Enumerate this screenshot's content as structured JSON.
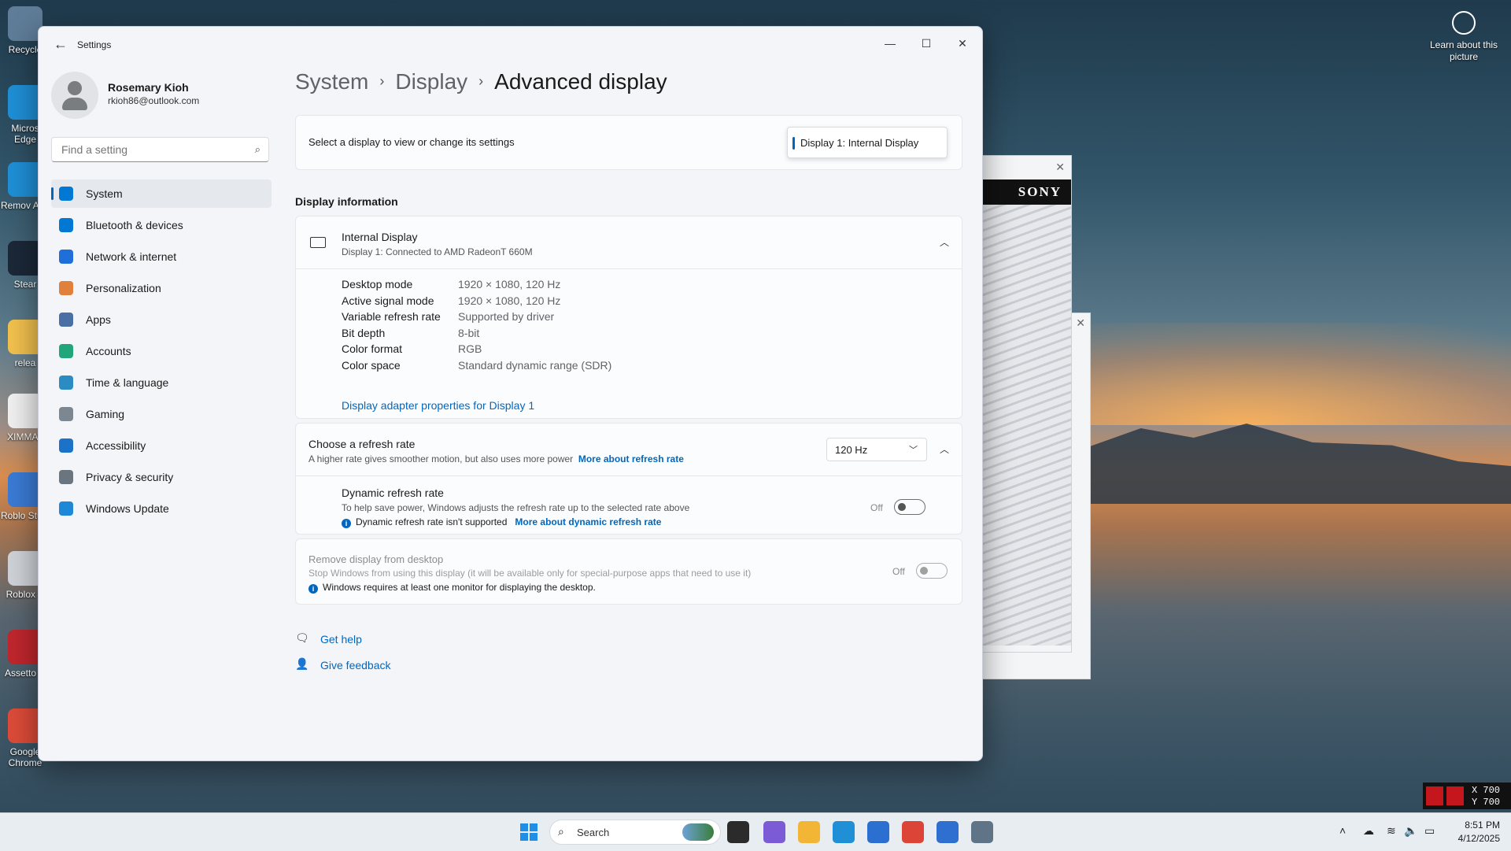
{
  "desktop": {
    "icons": [
      {
        "label": "Recycle",
        "color": "#5f7d98"
      },
      {
        "label": "Micros Edge",
        "color": "#1f8fd6"
      },
      {
        "label": "Remov App",
        "color": "#1f8fd6"
      },
      {
        "label": "Stear",
        "color": "#1b2838"
      },
      {
        "label": "relea",
        "color": "#f2c14e"
      },
      {
        "label": "XIMMAT",
        "color": "#f0f0f0"
      },
      {
        "label": "Roblo Studi",
        "color": "#3a7bd5"
      },
      {
        "label": "Roblox P",
        "color": "#cfd3d8"
      },
      {
        "label": "Assetto C",
        "color": "#c0262d"
      },
      {
        "label": "Google Chrome",
        "color": "#dd4b39"
      }
    ],
    "learn_about": "Learn about this picture",
    "coords": {
      "x": "X 700",
      "y": "Y 700"
    }
  },
  "window": {
    "app_title": "Settings",
    "controls": {
      "minimize": "—",
      "maximize": "☐",
      "close": "✕"
    },
    "back_icon": "←"
  },
  "profile": {
    "name": "Rosemary Kioh",
    "email": "rkioh86@outlook.com"
  },
  "search": {
    "placeholder": "Find a setting"
  },
  "nav": [
    {
      "label": "System",
      "icon": "system-icon",
      "color": "#0078d4",
      "selected": true
    },
    {
      "label": "Bluetooth & devices",
      "icon": "bluetooth-icon",
      "color": "#0078d4"
    },
    {
      "label": "Network & internet",
      "icon": "wifi-icon",
      "color": "#1e6fd9"
    },
    {
      "label": "Personalization",
      "icon": "brush-icon",
      "color": "#e0803a"
    },
    {
      "label": "Apps",
      "icon": "apps-icon",
      "color": "#4a6fa5"
    },
    {
      "label": "Accounts",
      "icon": "accounts-icon",
      "color": "#21a67a"
    },
    {
      "label": "Time & language",
      "icon": "clock-icon",
      "color": "#2b8cc4"
    },
    {
      "label": "Gaming",
      "icon": "gamepad-icon",
      "color": "#7d8791"
    },
    {
      "label": "Accessibility",
      "icon": "accessibility-icon",
      "color": "#1a73c9"
    },
    {
      "label": "Privacy & security",
      "icon": "shield-icon",
      "color": "#6b7580"
    },
    {
      "label": "Windows Update",
      "icon": "update-icon",
      "color": "#1e88d8"
    }
  ],
  "breadcrumb": {
    "level1": "System",
    "level2": "Display",
    "current": "Advanced display",
    "separator": "›"
  },
  "select_display": {
    "label": "Select a display to view or change its settings",
    "value": "Display 1: Internal Display"
  },
  "display_info": {
    "section_title": "Display information",
    "name": "Internal Display",
    "subtitle": "Display 1: Connected to AMD RadeonT 660M",
    "rows": [
      {
        "key": "Desktop mode",
        "value": "1920 × 1080, 120 Hz"
      },
      {
        "key": "Active signal mode",
        "value": "1920 × 1080, 120 Hz"
      },
      {
        "key": "Variable refresh rate",
        "value": "Supported by driver"
      },
      {
        "key": "Bit depth",
        "value": "8-bit"
      },
      {
        "key": "Color format",
        "value": "RGB"
      },
      {
        "key": "Color space",
        "value": "Standard dynamic range (SDR)"
      }
    ],
    "adapter_link": "Display adapter properties for Display 1"
  },
  "refresh": {
    "title": "Choose a refresh rate",
    "desc": "A higher rate gives smoother motion, but also uses more power",
    "link": "More about refresh rate",
    "value": "120 Hz"
  },
  "dynamic": {
    "title": "Dynamic refresh rate",
    "desc": "To help save power, Windows adjusts the refresh rate up to the selected rate above",
    "warning": "Dynamic refresh rate isn't supported",
    "link": "More about dynamic refresh rate",
    "state": "Off"
  },
  "remove_display": {
    "title": "Remove display from desktop",
    "desc": "Stop Windows from using this display (it will be available only for special-purpose apps that need to use it)",
    "note": "Windows requires at least one monitor for displaying the desktop.",
    "state": "Off"
  },
  "help": {
    "get_help": "Get help",
    "give_feedback": "Give feedback"
  },
  "sony": {
    "brand": "SONY",
    "close": "✕"
  },
  "taskbar": {
    "search_label": "Search",
    "time": "8:51 PM",
    "date": "4/12/2025",
    "apps": [
      {
        "name": "start-icon",
        "color": "#1e8fe6"
      },
      {
        "name": "terminal-icon",
        "color": "#2b2b2b"
      },
      {
        "name": "copilot-m365-icon",
        "color": "#7b5cd6"
      },
      {
        "name": "file-explorer-icon",
        "color": "#f2b535"
      },
      {
        "name": "edge-icon",
        "color": "#1f8fd6"
      },
      {
        "name": "store-icon",
        "color": "#2b6fd1"
      },
      {
        "name": "chrome-icon",
        "color": "#db4437"
      },
      {
        "name": "app-icon",
        "color": "#2f6fcf"
      },
      {
        "name": "settings-icon",
        "color": "#5f7486"
      }
    ]
  }
}
